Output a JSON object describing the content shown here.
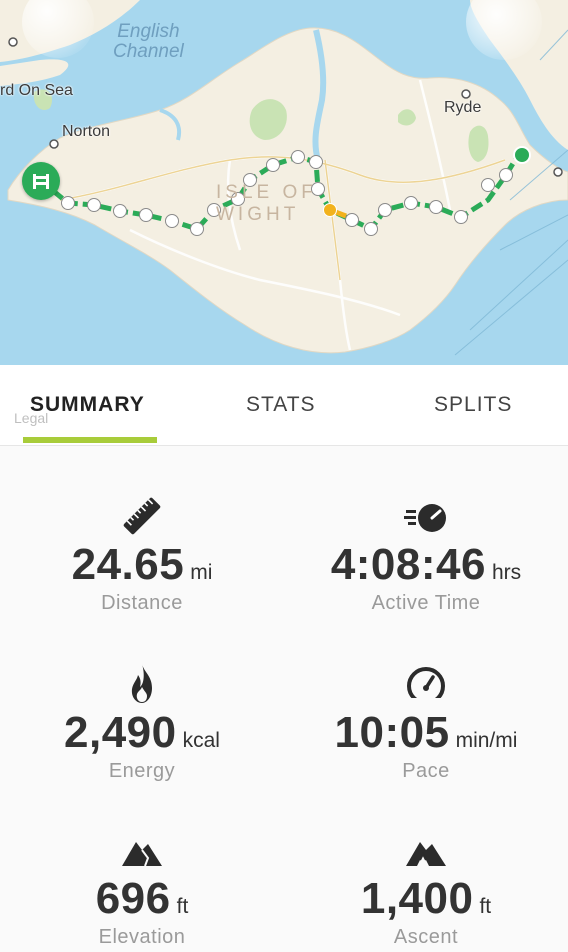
{
  "map": {
    "labels": {
      "channel": "English Channel",
      "channel_line1": "English",
      "channel_line2": "Channel",
      "ryde": "Ryde",
      "norton": "Norton",
      "yarmouth_partial": "rd On Sea",
      "island_line1": "ISLE OF",
      "island_line2": "WIGHT"
    },
    "legal": "Legal",
    "colors": {
      "water": "#a7d7ee",
      "land": "#f4efe2",
      "park": "#c9e3b4",
      "route": "#2bab58",
      "route_paused": "#f2b21d",
      "start_marker": "#2bab58"
    },
    "start_marker_icon": "flag-icon"
  },
  "tabs": [
    {
      "label": "SUMMARY",
      "active": true
    },
    {
      "label": "STATS",
      "active": false
    },
    {
      "label": "SPLITS",
      "active": false
    }
  ],
  "stats": {
    "distance": {
      "value": "24.65",
      "unit": "mi",
      "label": "Distance",
      "icon": "ruler-icon"
    },
    "active_time": {
      "value": "4:08:46",
      "unit": "hrs",
      "label": "Active Time",
      "icon": "stopwatch-icon"
    },
    "energy": {
      "value": "2,490",
      "unit": "kcal",
      "label": "Energy",
      "icon": "flame-icon"
    },
    "pace": {
      "value": "10:05",
      "unit": "min/mi",
      "label": "Pace",
      "icon": "speedometer-icon"
    },
    "elevation": {
      "value": "696",
      "unit": "ft",
      "label": "Elevation",
      "icon": "mountain-icon"
    },
    "ascent": {
      "value": "1,400",
      "unit": "ft",
      "label": "Ascent",
      "icon": "ascent-icon"
    }
  },
  "accent_color": "#a8cc3a"
}
